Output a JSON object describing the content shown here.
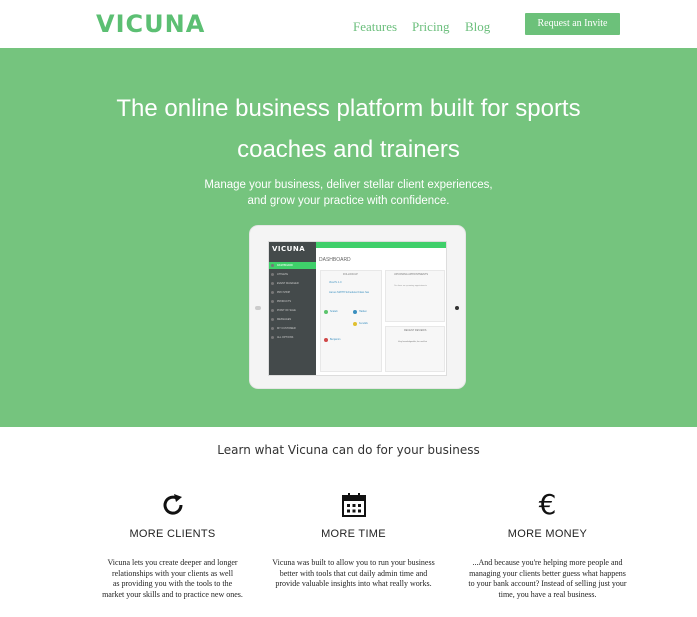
{
  "header": {
    "logo": "VICUNA",
    "nav": [
      "Features",
      "Pricing",
      "Blog"
    ],
    "cta_label": "Request an Invite"
  },
  "hero": {
    "title_line1": "The online business platform built for sports",
    "title_line2": "coaches and trainers",
    "sub_line1": "Manage your business, deliver stellar client experiences,",
    "sub_line2": "and grow your practice with confidence."
  },
  "dashboard": {
    "logo": "VICUNA",
    "title": "DASHBOARD",
    "menu": [
      "DASHBOARD",
      "ATHLETE",
      "EVENT MANAGER",
      "PRO SHOP",
      "PRODUCTS",
      "POINT OF SALE",
      "MESSAGES",
      "MY CUSTOMER",
      "ALL OPTIONS"
    ],
    "panels": {
      "followup": "FOLLOW-UP",
      "appointments": "UPCOMING APPOINTMENTS",
      "appointments_note": "You have no upcoming appointments",
      "reviews": "RECENT REVIEWS",
      "review_text": "Very knowledgeable; fun and fair"
    },
    "followup_items": [
      "Vicar?s 1.0",
      "James SMITH Scheduled Class has",
      "Scaleb",
      "Haiden",
      "Kendick",
      "Benjamin",
      "Recohanes"
    ]
  },
  "features": {
    "heading": "Learn what Vicuna can do for your business",
    "items": [
      {
        "icon": "refresh-icon",
        "title": "MORE CLIENTS",
        "text_lines": [
          "Vicuna lets you create deeper and longer",
          "relationships with your clients as well",
          "as providing you with the tools to the",
          "market your skills and to practice new ones."
        ]
      },
      {
        "icon": "calendar-icon",
        "title": "MORE TIME",
        "text_lines": [
          "Vicuna was built to allow you to run your business",
          "better with tools that cut daily admin time and",
          "provide valuable insights into what really works."
        ]
      },
      {
        "icon": "euro-icon",
        "title": "MORE MONEY",
        "text_lines": [
          "...And because you're helping more people and",
          "managing your clients better guess what happens",
          "to your bank account? Instead of selling just your",
          "time, you have a real business."
        ]
      }
    ]
  },
  "colors": {
    "brand_green": "#75c47e",
    "logo_green": "#5cbf73",
    "screen_green": "#3fcf6a",
    "sidebar_dark": "#444a4b"
  }
}
